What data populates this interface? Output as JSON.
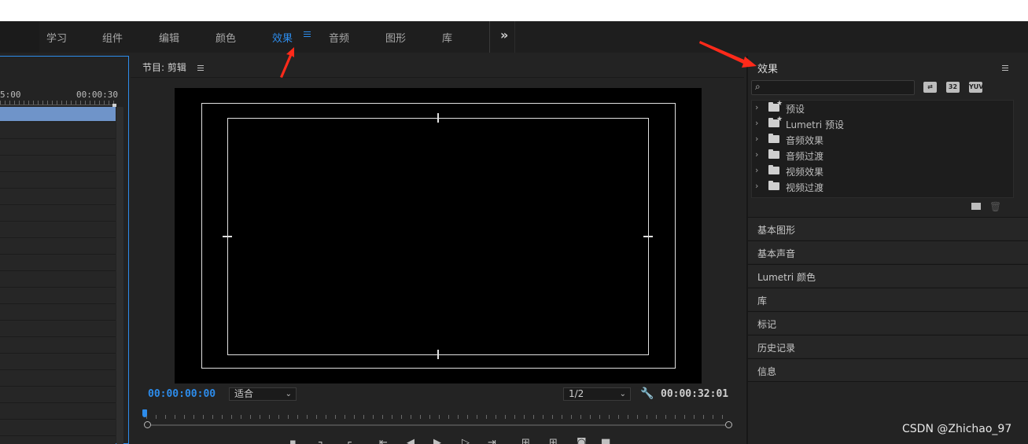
{
  "workspace": {
    "tabs": [
      "学习",
      "组件",
      "编辑",
      "颜色",
      "效果",
      "音频",
      "图形",
      "库"
    ],
    "active_tab": "效果",
    "more_label": "»"
  },
  "timeline": {
    "ruler_left": "5:00",
    "ruler_right": "00:00:30"
  },
  "program": {
    "title": "节目: 剪辑",
    "timecode_current": "00:00:00:00",
    "zoom": "适合",
    "resolution": "1/2",
    "timecode_duration": "00:00:32:01"
  },
  "effects_panel": {
    "title": "效果",
    "search_placeholder": "",
    "filter_icons": [
      "32",
      "YUV"
    ],
    "tree": [
      "预设",
      "Lumetri 预设",
      "音频效果",
      "音频过渡",
      "视频效果",
      "视频过渡"
    ]
  },
  "sections": [
    "基本图形",
    "基本声音",
    "Lumetri 颜色",
    "库",
    "标记",
    "历史记录",
    "信息"
  ],
  "watermark": "CSDN @Zhichao_97",
  "colors": {
    "accent": "#2d8ceb",
    "annotation": "#ff2a1a"
  }
}
